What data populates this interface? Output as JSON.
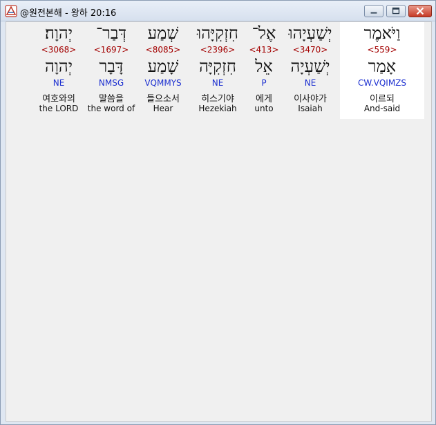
{
  "window": {
    "title": "@원전본해 - 왕하 20:16",
    "controls": {
      "minimize": "minimize",
      "maximize": "maximize",
      "close": "close"
    }
  },
  "words": [
    {
      "heb": "וַיֹּאמֶר",
      "strong": "<559>",
      "lemma": "אָמַר",
      "parse": "CW.VQIMZS",
      "kor": "이르되",
      "eng": "And-said"
    },
    {
      "heb": "יְשַׁעְיָהוּ",
      "strong": "<3470>",
      "lemma": "יְשַׁעְיָה",
      "parse": "NE",
      "kor": "이사야가",
      "eng": "Isaiah"
    },
    {
      "heb": "אֶל־",
      "strong": "<413>",
      "lemma": "אֵל",
      "parse": "P",
      "kor": "에게",
      "eng": "unto"
    },
    {
      "heb": "חִזְקִיָּהוּ",
      "strong": "<2396>",
      "lemma": "חִזְקִיָּה",
      "parse": "NE",
      "kor": "히스기야",
      "eng": "Hezekiah"
    },
    {
      "heb": "שְׁמַע",
      "strong": "<8085>",
      "lemma": "שָׁמַע",
      "parse": "VQMMYS",
      "kor": "들으소서",
      "eng": "Hear"
    },
    {
      "heb": "דְּבַר־",
      "strong": "<1697>",
      "lemma": "דָּבָר",
      "parse": "NMSG",
      "kor": "말씀을",
      "eng": "the word of"
    },
    {
      "heb": "יְהוָה׃",
      "strong": "<3068>",
      "lemma": "יְהוָה",
      "parse": "NE",
      "kor": "여호와의",
      "eng": "the LORD"
    }
  ],
  "colors": {
    "strong": "#a30000",
    "parse": "#1c2fd0",
    "selected_bg": "#ffffff"
  }
}
